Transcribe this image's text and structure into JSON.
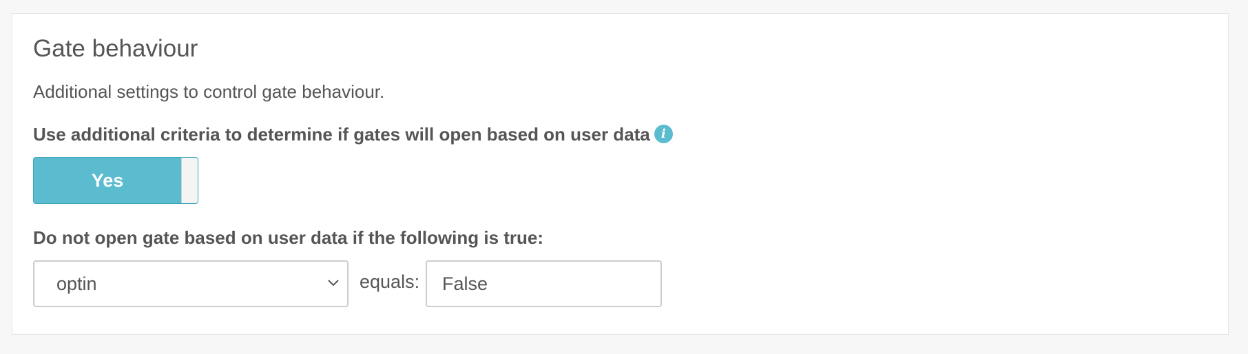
{
  "panel": {
    "title": "Gate behaviour",
    "description": "Additional settings to control gate behaviour."
  },
  "criteria": {
    "label": "Use additional criteria to determine if gates will open based on user data",
    "info_icon": "info-icon",
    "info_glyph": "i",
    "toggle": {
      "label": "Yes",
      "state": "on",
      "color": "#5bbcd0"
    }
  },
  "condition": {
    "label": "Do not open gate based on user data if the following is true:",
    "field_select": {
      "value": "optin",
      "icon": "chevron-down-icon"
    },
    "operator_label": "equals:",
    "value_input": {
      "value": "False"
    }
  },
  "colors": {
    "accent": "#5bbcd0",
    "text": "#555555",
    "background": "#f7f7f7"
  }
}
